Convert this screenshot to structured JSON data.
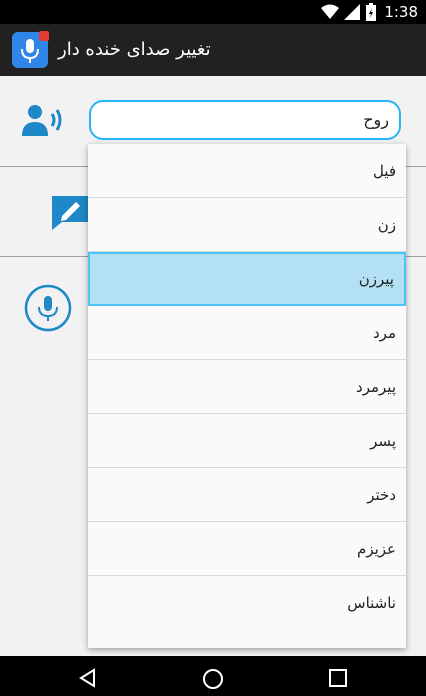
{
  "status_bar": {
    "time": "1:38",
    "icons": [
      "wifi-icon",
      "signal-icon",
      "battery-charging-icon"
    ]
  },
  "app_bar": {
    "title": "تغییر صدای خنده دار",
    "icon": "microphone-app-icon"
  },
  "voice_selector": {
    "value": "روح",
    "icon": "speaker-icon"
  },
  "text_row": {
    "icon": "edit-message-icon"
  },
  "record_row": {
    "icon": "microphone-icon"
  },
  "dropdown": {
    "items": [
      "فیل",
      "زن",
      "پیرزن",
      "مرد",
      "پیرمرد",
      "پسر",
      "دختر",
      "عزیزم",
      "ناشناس"
    ],
    "selected": "پیرزن"
  },
  "nav_bar": {
    "icons": [
      "back-icon",
      "home-icon",
      "recents-icon"
    ]
  },
  "colors": {
    "accent": "#29b6f6",
    "selected_bg": "#b3e0f2",
    "app_bar": "#212121"
  }
}
